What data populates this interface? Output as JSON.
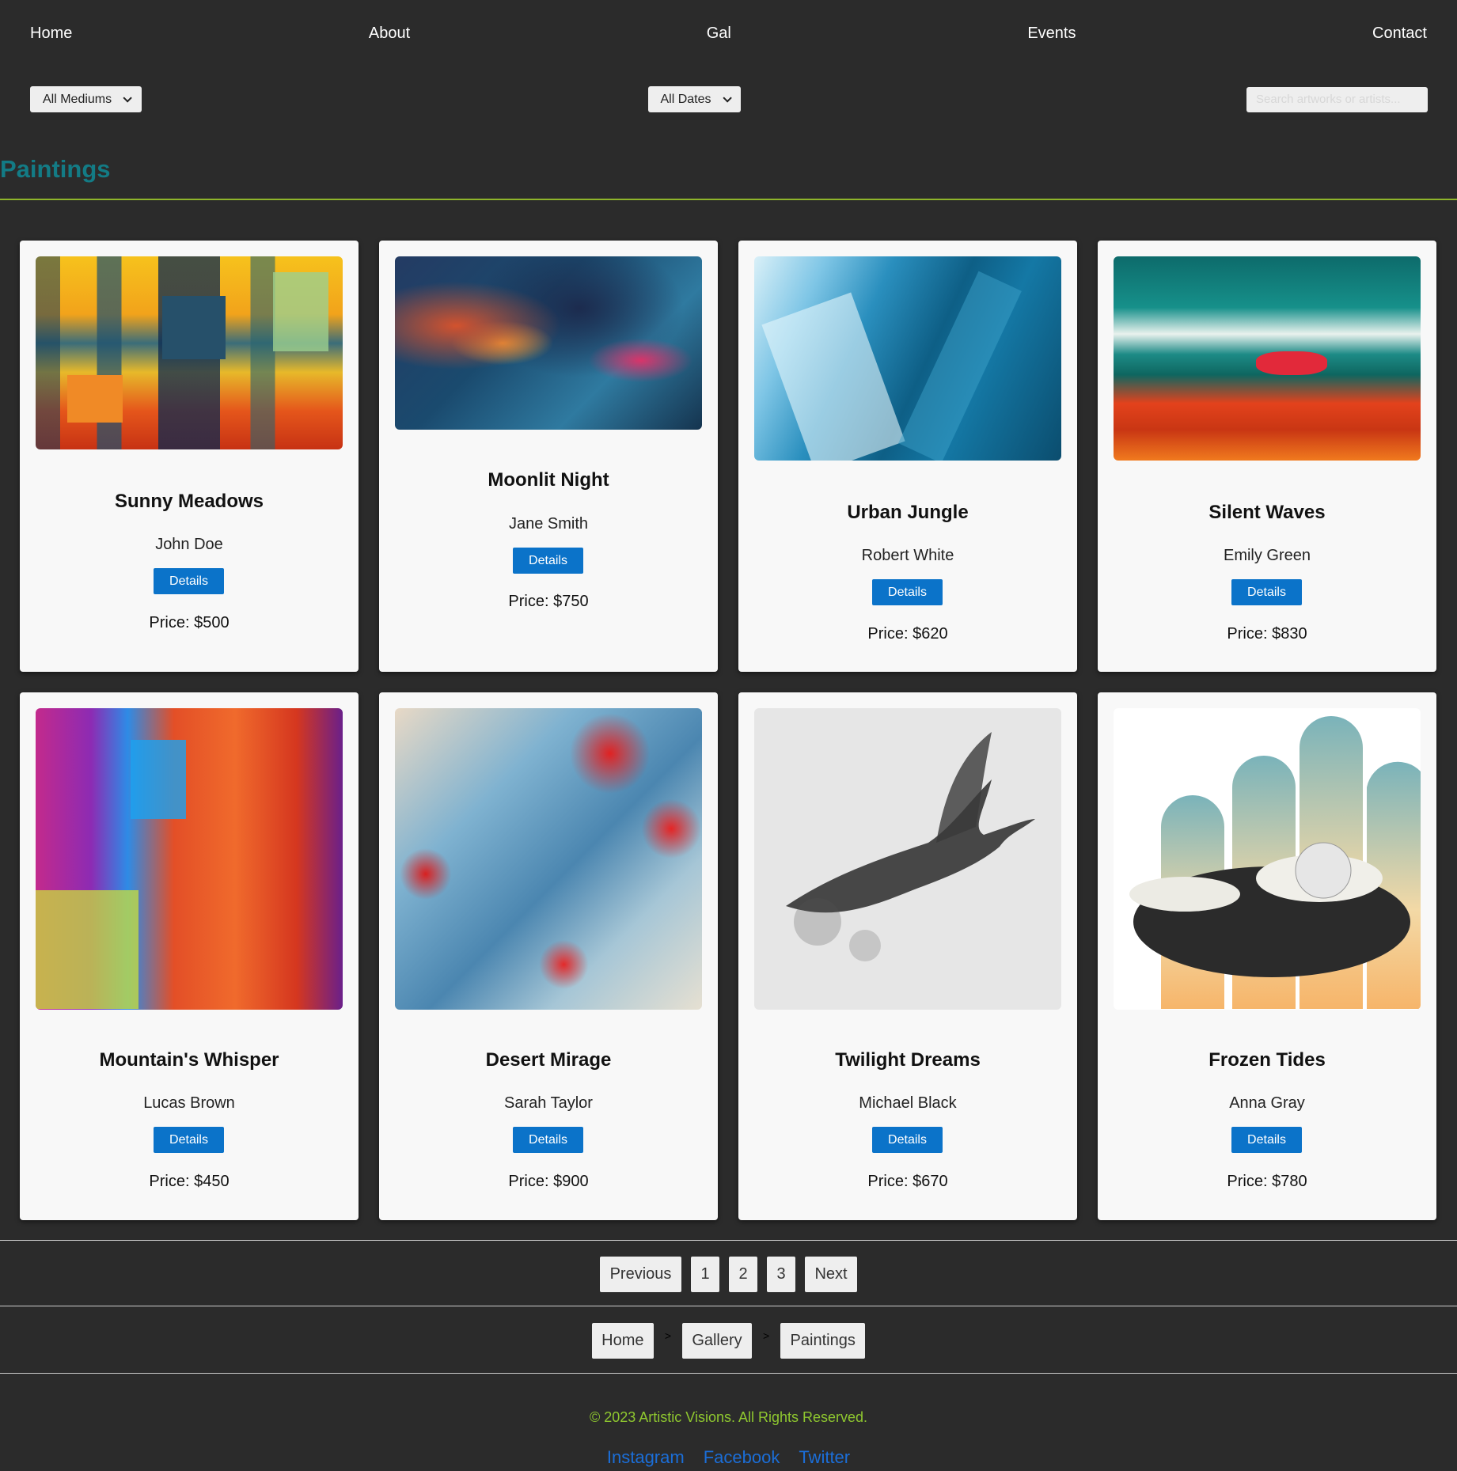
{
  "nav": [
    "Home",
    "About",
    "Gal",
    "Events",
    "Contact"
  ],
  "filters": {
    "medium": "All Mediums",
    "date": "All Dates",
    "search_placeholder": "Search artworks or artists..."
  },
  "section": {
    "title": "Paintings"
  },
  "cards": [
    {
      "title": "Sunny Meadows",
      "artist": "John Doe",
      "button": "Details",
      "price": "Price: $500"
    },
    {
      "title": "Moonlit Night",
      "artist": "Jane Smith",
      "button": "Details",
      "price": "Price: $750"
    },
    {
      "title": "Urban Jungle",
      "artist": "Robert White",
      "button": "Details",
      "price": "Price: $620"
    },
    {
      "title": "Silent Waves",
      "artist": "Emily Green",
      "button": "Details",
      "price": "Price: $830"
    },
    {
      "title": "Mountain's Whisper",
      "artist": "Lucas Brown",
      "button": "Details",
      "price": "Price: $450"
    },
    {
      "title": "Desert Mirage",
      "artist": "Sarah Taylor",
      "button": "Details",
      "price": "Price: $900"
    },
    {
      "title": "Twilight Dreams",
      "artist": "Michael Black",
      "button": "Details",
      "price": "Price: $670"
    },
    {
      "title": "Frozen Tides",
      "artist": "Anna Gray",
      "button": "Details",
      "price": "Price: $780"
    }
  ],
  "pagination": [
    "Previous",
    "1",
    "2",
    "3",
    "Next"
  ],
  "breadcrumb": [
    "Home",
    "Gallery",
    "Paintings"
  ],
  "breadcrumb_sep": ">",
  "footer": {
    "copyright": "© 2023 Artistic Visions. All Rights Reserved.",
    "social": [
      "Instagram",
      "Facebook",
      "Twitter"
    ]
  },
  "colors": {
    "accent_title": "#137b85",
    "accent_rule": "#8fb52b",
    "button_blue": "#0b73c9",
    "footer_green": "#8fc82f",
    "link_blue": "#1b6ed8"
  }
}
